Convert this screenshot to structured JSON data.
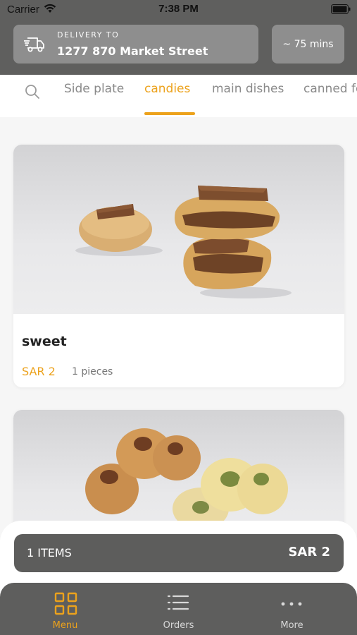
{
  "status_bar": {
    "carrier": "Carrier",
    "time": "7:38 PM"
  },
  "header": {
    "delivery_label": "DELIVERY TO",
    "delivery_address": "1277 870 Market Street",
    "eta": "~ 75 mins",
    "icon": "delivery-truck-icon"
  },
  "categories": {
    "search_icon": "search-icon",
    "tabs": [
      {
        "label": "Side plate",
        "active": false
      },
      {
        "label": "candies",
        "active": true
      },
      {
        "label": "main dishes",
        "active": false
      },
      {
        "label": "canned fo",
        "active": false
      }
    ]
  },
  "products": [
    {
      "name": "sweet",
      "price": "SAR 2",
      "quantity": "1 pieces"
    }
  ],
  "cart": {
    "items_label": "1 ITEMS",
    "total": "SAR 2"
  },
  "bottom_nav": {
    "items": [
      {
        "label": "Menu",
        "icon": "grid-icon",
        "active": true
      },
      {
        "label": "Orders",
        "icon": "list-icon",
        "active": false
      },
      {
        "label": "More",
        "icon": "more-dots-icon",
        "active": false
      }
    ]
  },
  "colors": {
    "accent": "#eca21c",
    "header_bg": "#5f5f5e",
    "card_bg": "#8e8e8e"
  }
}
